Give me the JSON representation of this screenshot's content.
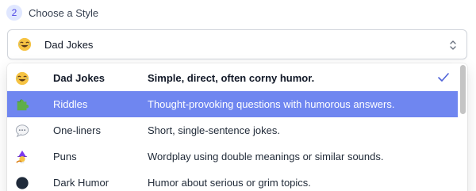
{
  "step": {
    "number": "2",
    "label": "Choose a Style"
  },
  "select": {
    "value": "Dad Jokes",
    "icon": "laughing-emoji"
  },
  "options": [
    {
      "name": "Dad Jokes",
      "description": "Simple, direct, often corny humor.",
      "icon": "laughing-emoji",
      "selected": true
    },
    {
      "name": "Riddles",
      "description": "Thought-provoking questions with humorous answers.",
      "icon": "puzzle-piece-emoji",
      "active": true
    },
    {
      "name": "One-liners",
      "description": "Short, single-sentence jokes.",
      "icon": "speech-bubble-emoji"
    },
    {
      "name": "Puns",
      "description": "Wordplay using double meanings or similar sounds.",
      "icon": "wizard-emoji"
    },
    {
      "name": "Dark Humor",
      "description": "Humor about serious or grim topics.",
      "icon": "dark-circle-emoji"
    }
  ],
  "colors": {
    "accent": "#6f86f0",
    "badge_bg": "#e0e7ff",
    "badge_text": "#4f46e5"
  }
}
